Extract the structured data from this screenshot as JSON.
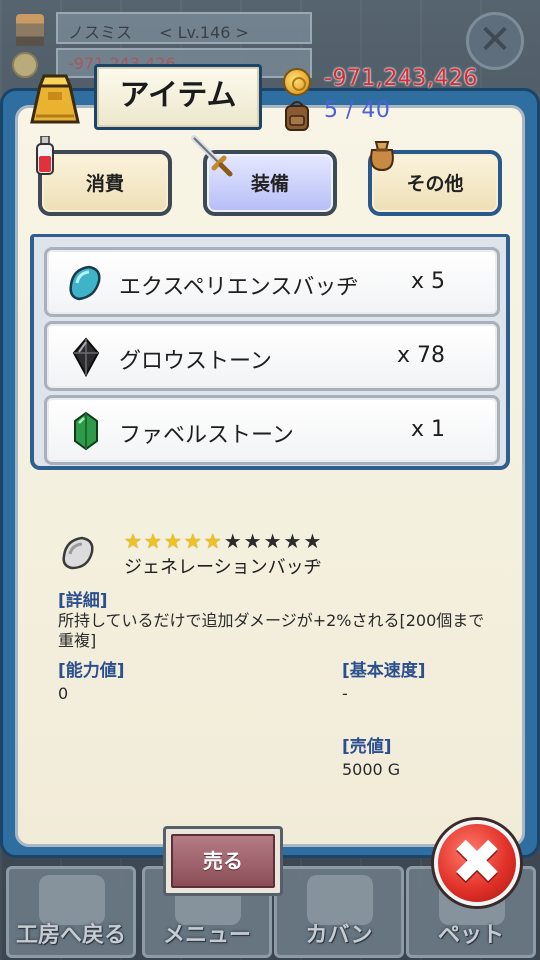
{
  "background": {
    "player_name": "ノスミス",
    "player_level": "< Lv.146 >",
    "player_money": "-971,243,426"
  },
  "header": {
    "title": "アイテム",
    "money": "-971,243,426",
    "capacity": "5 / 40"
  },
  "tabs": [
    {
      "label": "消費",
      "active": false,
      "icon": "potion-icon"
    },
    {
      "label": "装備",
      "active": true,
      "icon": "sword-icon"
    },
    {
      "label": "その他",
      "active": false,
      "icon": "pouch-icon"
    }
  ],
  "items": [
    {
      "name": "エクスペリエンスバッヂ",
      "qty": "x 5",
      "icon": "blue-gem-icon"
    },
    {
      "name": "グロウストーン",
      "qty": "x 78",
      "icon": "black-crystal-icon"
    },
    {
      "name": "ファベルストーン",
      "qty": "x 1",
      "icon": "green-crystal-icon"
    }
  ],
  "detail": {
    "icon": "badge-icon",
    "rating": 5,
    "rating_max": 10,
    "name": "ジェネレーションバッヂ",
    "detail_label": "[詳細]",
    "detail_text": "所持しているだけで追加ダメージが+2%される[200個まで重複]",
    "ability_label": "[能力値]",
    "ability_value": "0",
    "speed_label": "[基本速度]",
    "speed_value": "-",
    "price_label": "[売値]",
    "price_value": "5000 G"
  },
  "actions": {
    "sell_label": "売る",
    "close_label": "✖"
  },
  "bottom_nav": [
    {
      "label": "工房へ戻る"
    },
    {
      "label": "メニュー"
    },
    {
      "label": "カバン"
    },
    {
      "label": "ペット"
    }
  ],
  "colors": {
    "panel_blue": "#2f6ea0",
    "money_red": "#d92b35",
    "capacity_blue": "#4a62d8",
    "section_label": "#2b4f8f",
    "star_on": "#f2c21c"
  }
}
